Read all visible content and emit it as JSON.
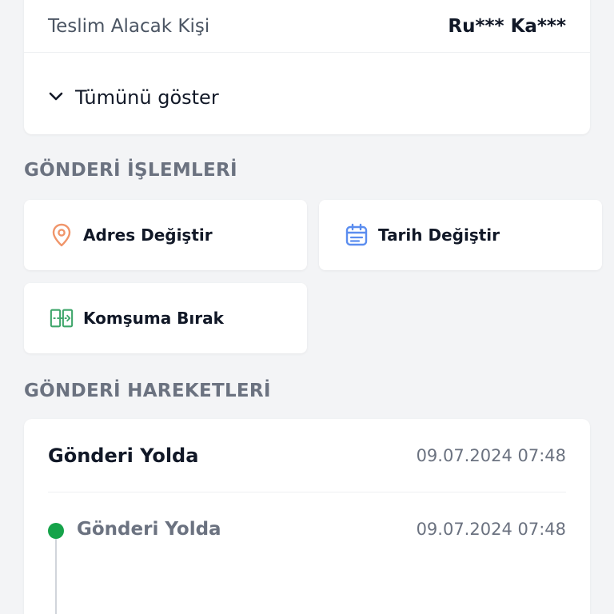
{
  "info": {
    "recipient_label": "Teslim Alacak Kişi",
    "recipient_value": "Ru*** Ka***",
    "show_all_label": "Tümünü göster"
  },
  "shipment_actions": {
    "title": "GÖNDERİ İŞLEMLERİ",
    "buttons": [
      {
        "label": "Adres Değiştir",
        "icon": "location-pin-icon",
        "color": "#f0956a"
      },
      {
        "label": "Tarih Değiştir",
        "icon": "calendar-icon",
        "color": "#5b8def"
      },
      {
        "label": "Komşuma Bırak",
        "icon": "neighbor-handover-icon",
        "color": "#3fa66b"
      }
    ]
  },
  "shipment_movements": {
    "title": "GÖNDERİ HAREKETLERİ",
    "current_status": "Gönderi Yolda",
    "current_date": "09.07.2024 07:48",
    "timeline": [
      {
        "label": "Gönderi Yolda",
        "date": "09.07.2024 07:48",
        "dot_color": "#16a34a"
      }
    ]
  },
  "colors": {
    "background": "#f3f4f6",
    "card": "#ffffff",
    "accent_green": "#16a34a"
  }
}
